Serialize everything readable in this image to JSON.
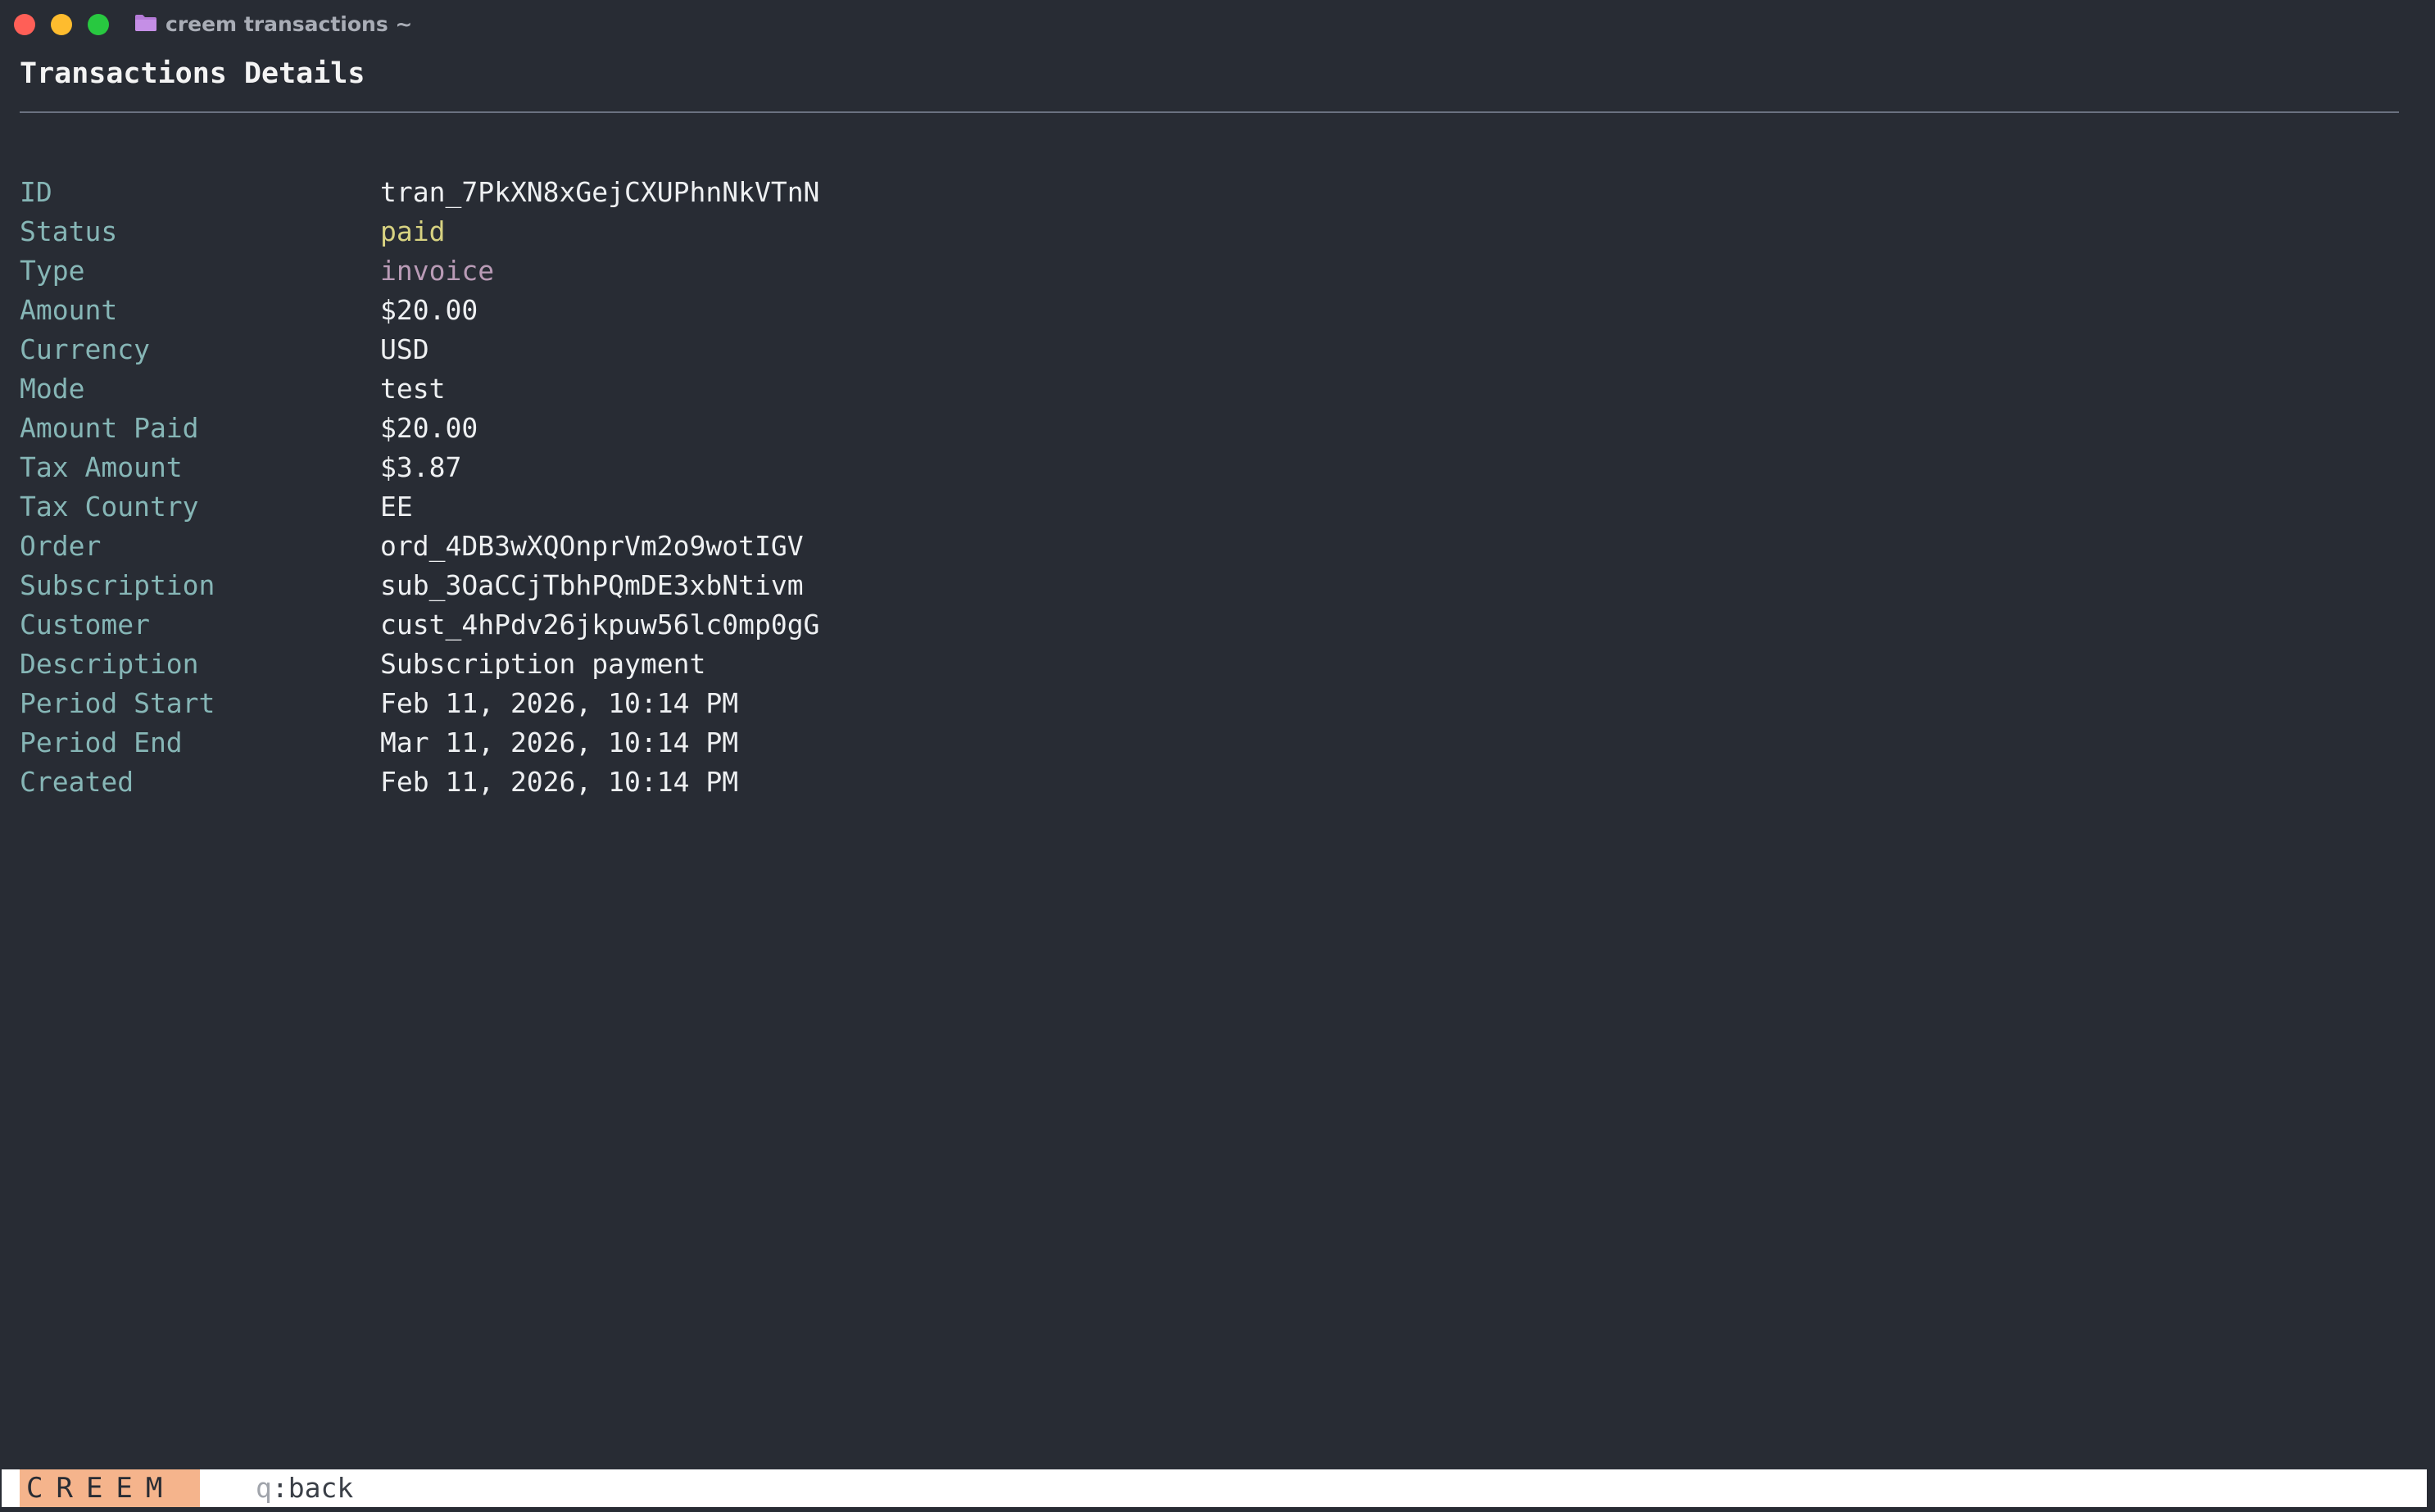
{
  "window": {
    "title": "creem transactions ~",
    "folder_icon": "folder-icon",
    "colors": {
      "background": "#282c34",
      "label": "#86b6b6",
      "value": "#eef0f2",
      "status": "#d7d281",
      "type": "#b99bb6",
      "brand_bg": "#f5b48c"
    }
  },
  "page": {
    "title": "Transactions Details"
  },
  "details": [
    {
      "label": "ID",
      "value": "tran_7PkXN8xGejCXUPhnNkVTnN"
    },
    {
      "label": "Status",
      "value": "paid"
    },
    {
      "label": "Type",
      "value": "invoice"
    },
    {
      "label": "Amount",
      "value": "$20.00"
    },
    {
      "label": "Currency",
      "value": "USD"
    },
    {
      "label": "Mode",
      "value": "test"
    },
    {
      "label": "Amount Paid",
      "value": "$20.00"
    },
    {
      "label": "Tax Amount",
      "value": "$3.87"
    },
    {
      "label": "Tax Country",
      "value": "EE"
    },
    {
      "label": "Order",
      "value": "ord_4DB3wXQOnprVm2o9wotIGV"
    },
    {
      "label": "Subscription",
      "value": "sub_3OaCCjTbhPQmDE3xbNtivm"
    },
    {
      "label": "Customer",
      "value": "cust_4hPdv26jkpuw56lc0mp0gG"
    },
    {
      "label": "Description",
      "value": "Subscription payment"
    },
    {
      "label": "Period Start",
      "value": "Feb 11, 2026, 10:14 PM"
    },
    {
      "label": "Period End",
      "value": "Mar 11, 2026, 10:14 PM"
    },
    {
      "label": "Created",
      "value": "Feb 11, 2026, 10:14 PM"
    }
  ],
  "statusbar": {
    "brand": "CREEM",
    "hint_key": "q",
    "hint_action": ":back"
  }
}
